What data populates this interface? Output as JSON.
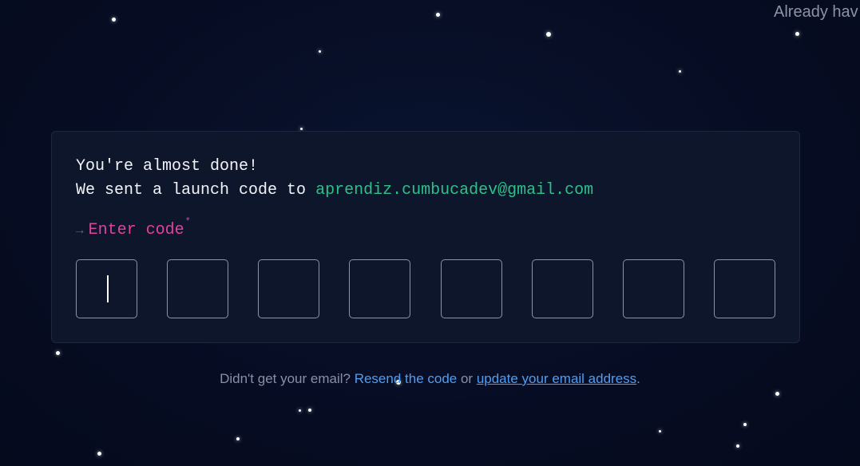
{
  "header": {
    "signin_text": "Already hav"
  },
  "card": {
    "line1": "You're almost done!",
    "line2_prefix": "We sent a launch code to ",
    "email": "aprendiz.cumbucadev@gmail.com",
    "prompt_arrow": "→",
    "prompt_label": "Enter code",
    "prompt_required_mark": "*",
    "code_length": 8,
    "code_values": [
      "",
      "",
      "",
      "",
      "",
      "",
      "",
      ""
    ]
  },
  "footer": {
    "prefix": "Didn't get your email? ",
    "resend_link": "Resend the code",
    "middle": " or ",
    "update_link": "update your email address",
    "suffix": "."
  },
  "colors": {
    "background": "#060c22",
    "card": "#0d162b",
    "email": "#2fc08a",
    "prompt": "#e0439c",
    "link": "#4f9ef5"
  }
}
